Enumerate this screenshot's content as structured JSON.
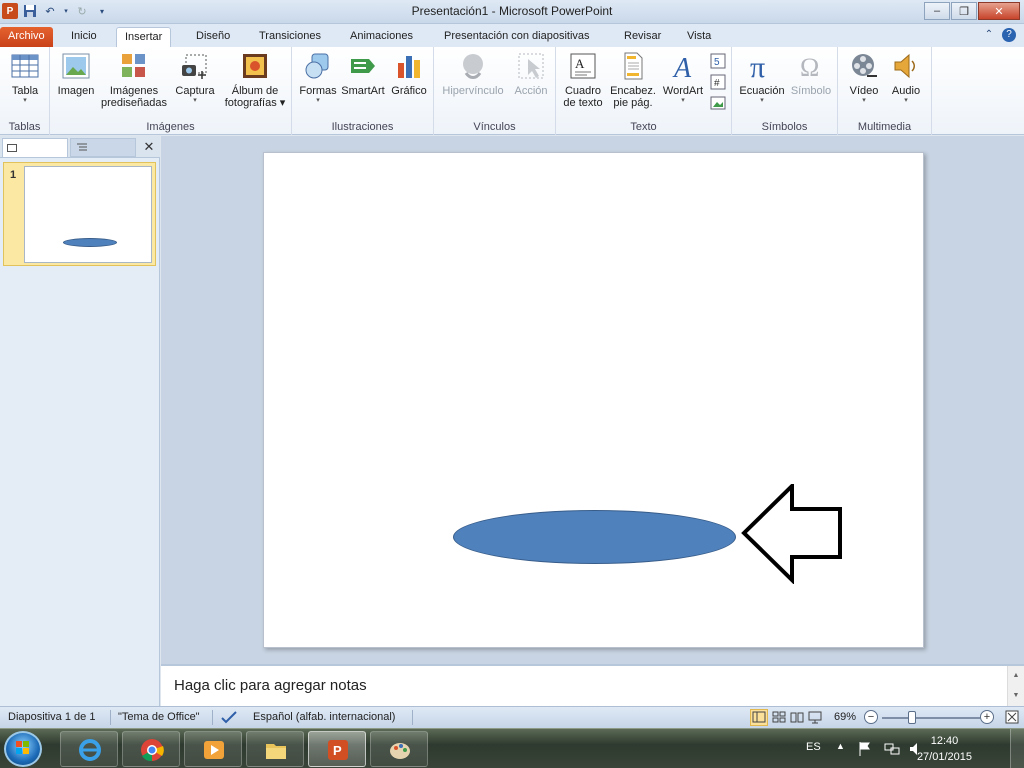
{
  "window": {
    "title": "Presentación1  -  Microsoft PowerPoint",
    "app_icon_letter": "P",
    "minimize_glyph": "‒",
    "maximize_glyph": "❐",
    "close_glyph": "✕"
  },
  "ribbon_tabs": [
    "Archivo",
    "Inicio",
    "Insertar",
    "Diseño",
    "Transiciones",
    "Animaciones",
    "Presentación con diapositivas",
    "Revisar",
    "Vista"
  ],
  "active_tab": "Insertar",
  "groups": {
    "tablas": {
      "label": "Tablas",
      "buttons": [
        {
          "label": "Tabla",
          "dropdown": "▾"
        }
      ]
    },
    "imagenes": {
      "label": "Imágenes",
      "buttons": [
        {
          "label": "Imagen"
        },
        {
          "label": "Imágenes\nprediseñadas"
        },
        {
          "label": "Captura",
          "dropdown": "▾"
        },
        {
          "label": "Álbum de\nfotografías ▾"
        }
      ]
    },
    "ilustraciones": {
      "label": "Ilustraciones",
      "buttons": [
        {
          "label": "Formas",
          "dropdown": "▾"
        },
        {
          "label": "SmartArt"
        },
        {
          "label": "Gráfico"
        }
      ]
    },
    "vinculos": {
      "label": "Vínculos",
      "buttons": [
        {
          "label": "Hipervínculo",
          "disabled": true
        },
        {
          "label": "Acción",
          "disabled": true
        }
      ]
    },
    "texto": {
      "label": "Texto",
      "buttons": [
        {
          "label": "Cuadro\nde texto"
        },
        {
          "label": "Encabez.\npie pág."
        },
        {
          "label": "WordArt",
          "dropdown": "▾"
        }
      ]
    },
    "simbolos": {
      "label": "Símbolos",
      "buttons": [
        {
          "label": "Ecuación",
          "dropdown": "▾"
        },
        {
          "label": "Símbolo",
          "disabled": true
        }
      ]
    },
    "multimedia": {
      "label": "Multimedia",
      "buttons": [
        {
          "label": "Vídeo",
          "dropdown": "▾"
        },
        {
          "label": "Audio",
          "dropdown": "▾"
        }
      ]
    }
  },
  "slide_panel": {
    "slide_number": "1",
    "close_glyph": "✕"
  },
  "notes": {
    "placeholder": "Haga clic para agregar notas"
  },
  "status": {
    "slide_info": "Diapositiva 1 de 1",
    "theme": "\"Tema de Office\"",
    "language": "Español (alfab. internacional)",
    "zoom": "69%",
    "zoom_level_percent": 69
  },
  "tray": {
    "lang": "ES",
    "time": "12:40",
    "date": "27/01/2015"
  },
  "colors": {
    "shape_fill": "#4f81bd",
    "shape_outline": "#385d8a",
    "file_tab": "#d24f23"
  }
}
